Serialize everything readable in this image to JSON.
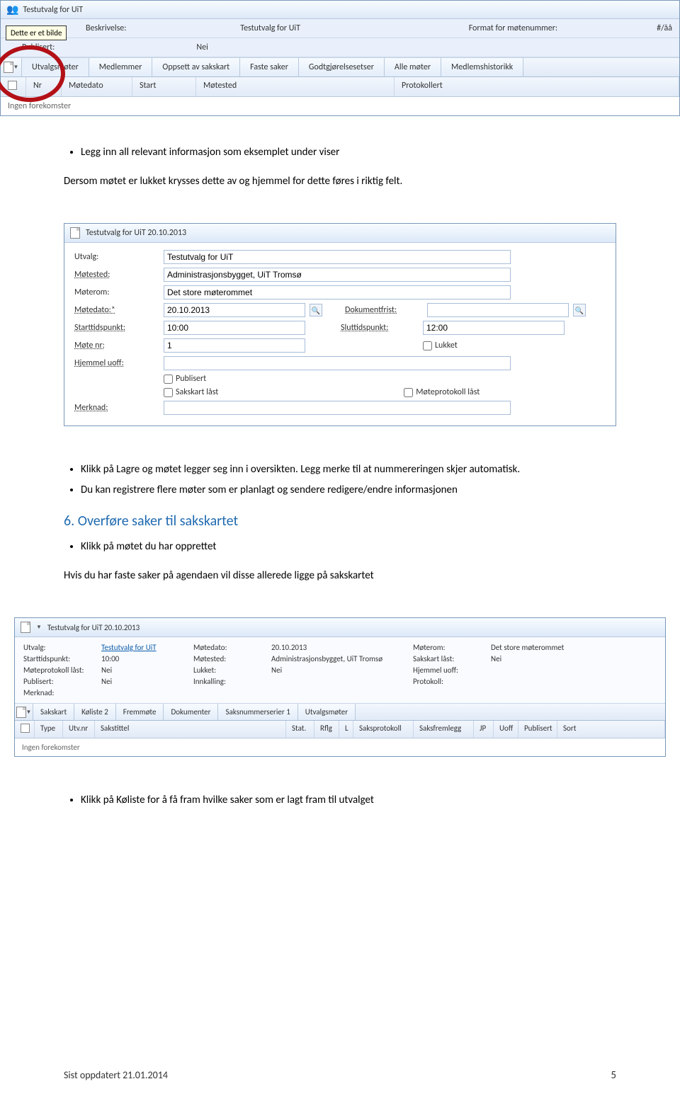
{
  "screenshot1": {
    "windowTitle": "Testutvalg for UiT",
    "tooltip": "Dette er et bilde",
    "beskrivelseLabel": "Beskrivelse:",
    "beskrivelseValue": "Testutvalg for UiT",
    "publisertLabel": "Publisert:",
    "publisertValue": "Nei",
    "formatLabel": "Format for møtenummer:",
    "formatValue": "#/åå",
    "tabs": [
      "Utvalgsmøter",
      "Medlemmer",
      "Oppsett av sakskart",
      "Faste saker",
      "Godtgjørelsesetser",
      "Alle møter",
      "Medlemshistorikk"
    ],
    "columns": {
      "nr": "Nr",
      "motedato": "Møtedato",
      "start": "Start",
      "motested": "Møtested",
      "protokollert": "Protokollert"
    },
    "emptyText": "Ingen forekomster"
  },
  "doc": {
    "p1_b1": "Legg inn all relevant informasjon som eksemplet under viser",
    "p1_sub": "Dersom møtet er lukket krysses dette av og hjemmel for dette føres i riktig felt.",
    "p2_b1": "Klikk på Lagre og møtet legger seg inn i oversikten. Legg merke til at nummereringen skjer automatisk.",
    "p2_b2": "Du kan registrere flere møter som er planlagt og sendere redigere/endre informasjonen",
    "h2": "6. Overføre saker til sakskartet",
    "p3_b1": "Klikk på møtet du har opprettet",
    "p3_sub": "Hvis du har faste saker på agendaen vil disse allerede ligge på sakskartet",
    "p4_b1": "Klikk på Køliste for å få fram hvilke saker som er lagt fram til utvalget"
  },
  "form": {
    "title": "Testutvalg for UiT  20.10.2013",
    "labels": {
      "utvalg": "Utvalg:",
      "motested": "Møtested:",
      "moterom": "Møterom:",
      "motedato": "Møtedato:*",
      "dokumentfrist": "Dokumentfrist:",
      "starttidspunkt": "Starttidspunkt:",
      "sluttidspunkt": "Sluttidspunkt:",
      "motenr": "Møte nr:",
      "lukket": "Lukket",
      "hjemmel": "Hjemmel uoff:",
      "publisert": "Publisert",
      "sakskartlast": "Sakskart låst",
      "moteprotokolllast": "Møteprotokoll låst",
      "merknad": "Merknad:"
    },
    "values": {
      "utvalg": "Testutvalg for UiT",
      "motested": "Administrasjonsbygget, UiT Tromsø",
      "moterom": "Det store møterommet",
      "motedato": "20.10.2013",
      "dokumentfrist": "",
      "starttidspunkt": "10:00",
      "sluttidspunkt": "12:00",
      "motenr": "1",
      "hjemmel": "",
      "merknad": ""
    }
  },
  "detail": {
    "title": "Testutvalg for UiT  20.10.2013",
    "info": {
      "utvalg_k": "Utvalg:",
      "utvalg_v": "Testutvalg for UiT",
      "motedato_k": "Møtedato:",
      "motedato_v": "20.10.2013",
      "moterom_k": "Møterom:",
      "moterom_v": "Det store møterommet",
      "start_k": "Starttidspunkt:",
      "start_v": "10:00",
      "motested_k": "Møtested:",
      "motested_v": "Administrasjonsbygget, UiT Tromsø",
      "sakskartlast_k": "Sakskart låst:",
      "sakskartlast_v": "Nei",
      "mplast_k": "Møteprotokoll låst:",
      "mplast_v": "Nei",
      "lukket_k": "Lukket:",
      "lukket_v": "Nei",
      "hjemmel_k": "Hjemmel uoff:",
      "hjemmel_v": "",
      "publisert_k": "Publisert:",
      "publisert_v": "Nei",
      "innkalling_k": "Innkalling:",
      "innkalling_v": "",
      "protokoll_k": "Protokoll:",
      "protokoll_v": "",
      "merknad_k": "Merknad:",
      "merknad_v": ""
    },
    "tabs": [
      "Sakskart",
      "Køliste  2",
      "Fremmøte",
      "Dokumenter",
      "Saksnummerserier  1",
      "Utvalgsmøter"
    ],
    "cols": [
      "Type",
      "Utv.nr",
      "Sakstittel",
      "Stat.",
      "Rflg",
      "L",
      "Saksprotokoll",
      "Saksfremlegg",
      "JP",
      "Uoff",
      "Publisert",
      "Sort"
    ],
    "emptyText": "Ingen forekomster"
  },
  "footer": {
    "updated": "Sist oppdatert 21.01.2014",
    "page": "5"
  }
}
